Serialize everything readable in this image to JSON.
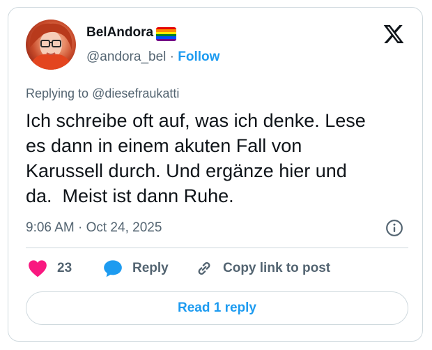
{
  "tweet": {
    "author": {
      "display_name": "BelAndora",
      "handle": "@andora_bel",
      "separator": "·",
      "follow_label": "Follow",
      "flag_colors": [
        "#e40303",
        "#ff8c00",
        "#ffed00",
        "#008026",
        "#004dff",
        "#750787"
      ]
    },
    "platform_icon": "x-logo-icon",
    "replying_to_prefix": "Replying to",
    "replying_to_handle": "@diesefraukatti",
    "text": "Ich schreibe oft auf, was ich denke. Lese\nes dann in einem akuten Fall von\nKarussell durch. Und ergänze hier und\nda.  Meist ist dann Ruhe.",
    "timestamp": "9:06 AM · Oct 24, 2025",
    "actions": {
      "like_count": "23",
      "reply_label": "Reply",
      "copy_label": "Copy link to post"
    },
    "read_replies_label": "Read 1 reply"
  },
  "colors": {
    "accent": "#1d9bf0",
    "like": "#f91880",
    "muted": "#536471",
    "border": "#cfd9de"
  }
}
